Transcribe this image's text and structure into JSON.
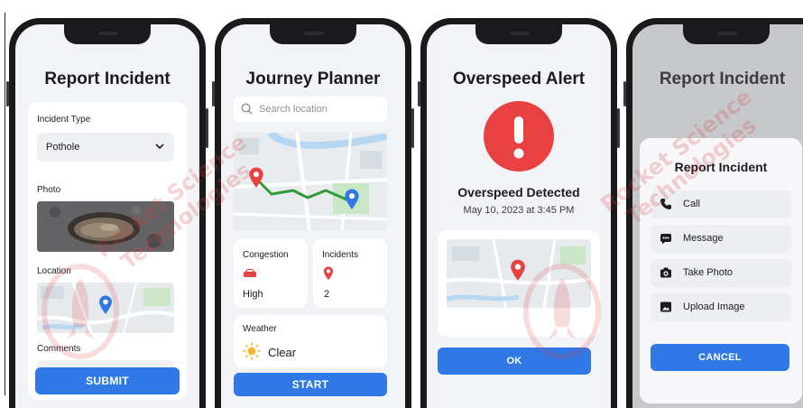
{
  "watermark": {
    "line1": "Rocket Science",
    "line2": "Technologies"
  },
  "colors": {
    "primary": "#2f78e6",
    "alert": "#e94040",
    "route": "#2f9a3a"
  },
  "report": {
    "title": "Report Incident",
    "incident_type_label": "Incident Type",
    "incident_type_value": "Pothole",
    "photo_label": "Photo",
    "location_label": "Location",
    "comments_label": "Comments",
    "submit_label": "SUBMIT"
  },
  "planner": {
    "title": "Journey Planner",
    "search_placeholder": "Search location",
    "congestion_label": "Congestion",
    "congestion_value": "High",
    "incidents_label": "Incidents",
    "incidents_value": "2",
    "weather_label": "Weather",
    "weather_value": "Clear",
    "start_label": "START"
  },
  "overspeed": {
    "title": "Overspeed Alert",
    "heading": "Overspeed Detected",
    "datetime": "May 10, 2023 at 3:45 PM",
    "ok_label": "OK"
  },
  "report_menu": {
    "title": "Report Incident",
    "sheet_title": "Report Incident",
    "options": [
      {
        "label": "Call",
        "icon": "phone-icon"
      },
      {
        "label": "Message",
        "icon": "message-icon"
      },
      {
        "label": "Take Photo",
        "icon": "camera-icon"
      },
      {
        "label": "Upload Image",
        "icon": "image-icon"
      }
    ],
    "cancel_label": "CANCEL"
  }
}
